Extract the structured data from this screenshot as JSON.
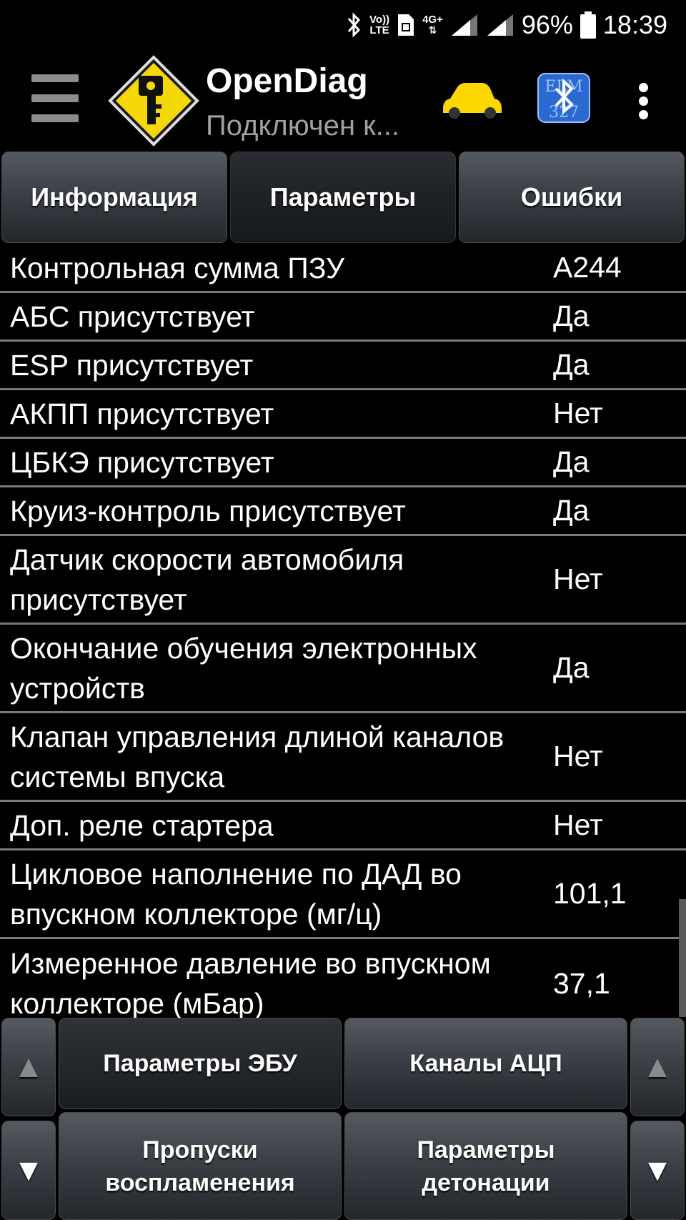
{
  "status_bar": {
    "volte_line1": "Vo))",
    "volte_line2": "LTE",
    "network": "4G+",
    "battery": "96%",
    "time": "18:39"
  },
  "app_bar": {
    "title": "OpenDiag",
    "subtitle": "Подключен к..."
  },
  "tabs": [
    {
      "label": "Информация"
    },
    {
      "label": "Параметры"
    },
    {
      "label": "Ошибки"
    }
  ],
  "params": [
    {
      "name": "Контрольная сумма ПЗУ",
      "value": "A244"
    },
    {
      "name": "АБС присутствует",
      "value": "Да"
    },
    {
      "name": "ESP присутствует",
      "value": "Да"
    },
    {
      "name": "АКПП присутствует",
      "value": "Нет"
    },
    {
      "name": "ЦБКЭ присутствует",
      "value": "Да"
    },
    {
      "name": "Круиз-контроль присутствует",
      "value": "Да"
    },
    {
      "name": "Датчик скорости автомобиля присутствует",
      "value": "Нет"
    },
    {
      "name": "Окончание обучения электронных устройств",
      "value": "Да"
    },
    {
      "name": "Клапан управления длиной каналов системы впуска",
      "value": "Нет"
    },
    {
      "name": "Доп. реле стартера",
      "value": "Нет"
    },
    {
      "name": "Цикловое наполнение по ДАД во впускном коллекторе (мг/ц)",
      "value": "101,1"
    },
    {
      "name": "Измеренное давление во впускном коллекторе (мБар)",
      "value": "37,1"
    }
  ],
  "bottom_buttons": {
    "ecu_params": "Параметры ЭБУ",
    "adc_channels": "Каналы АЦП",
    "misfire": "Пропуски воспламенения",
    "knock": "Параметры детонации"
  },
  "arrows": {
    "up": "▲",
    "down": "▼"
  },
  "colors": {
    "background": "#000000",
    "button_gradient_top": "#555a60",
    "button_gradient_bottom": "#23272c",
    "divider": "#7a7a7a",
    "logo_yellow": "#f5d80a",
    "car_yellow": "#ffd700",
    "bt_blue": "#2a6ad0"
  }
}
